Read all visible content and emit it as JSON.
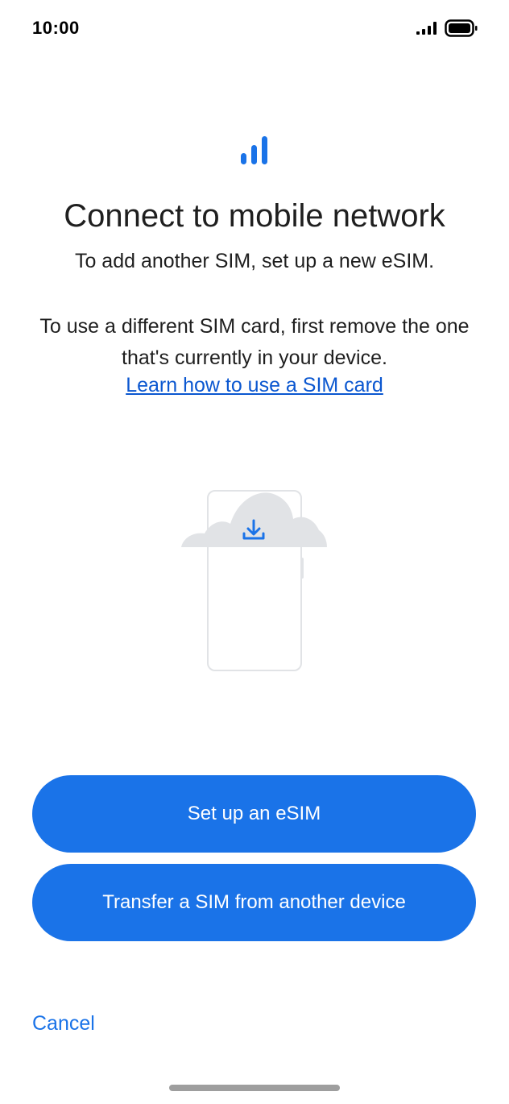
{
  "status_bar": {
    "time": "10:00"
  },
  "header": {
    "icon": "signal-bars-icon",
    "title": "Connect to mobile network",
    "subtitle": "To add another SIM, set up a new eSIM."
  },
  "body": {
    "text": "To use a different SIM card, first remove the one that's currently in your device.",
    "link_label": "Learn how to use a SIM card"
  },
  "illustration": {
    "icon": "phone-cloud-download-icon"
  },
  "actions": {
    "primary_label": "Set up an eSIM",
    "secondary_label": "Transfer a SIM from another device",
    "cancel_label": "Cancel"
  },
  "colors": {
    "accent": "#1a73e8",
    "link": "#0b57d0",
    "text": "#1f1f1f",
    "illustration_gray": "#e1e3e6"
  }
}
